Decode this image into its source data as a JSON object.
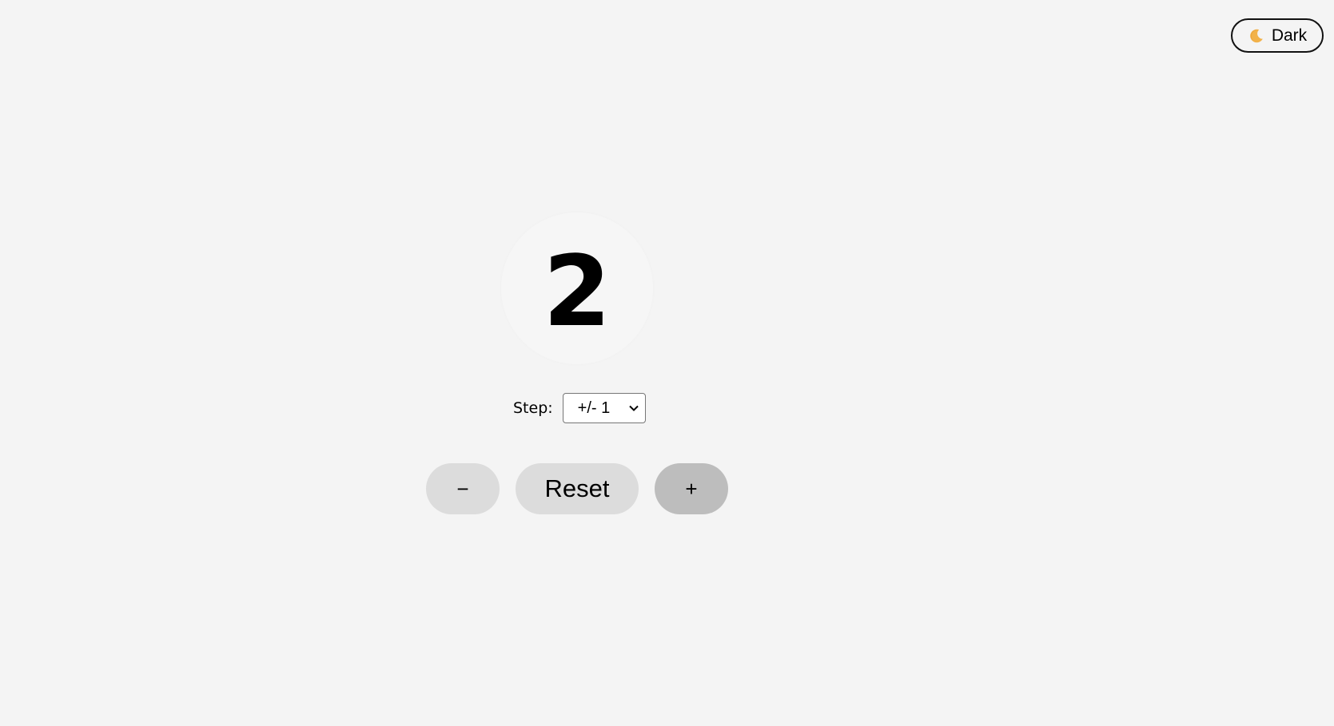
{
  "theme_toggle": {
    "icon": "moon-icon",
    "label": "Dark"
  },
  "counter": {
    "value": "2"
  },
  "step": {
    "label": "Step:",
    "selected": "+/- 1"
  },
  "buttons": {
    "decrement": "−",
    "reset": "Reset",
    "increment": "+"
  },
  "colors": {
    "background": "#f4f4f4",
    "button": "#dcdcdc",
    "button_active": "#bdbdbd",
    "moon": "#f2b24a"
  }
}
